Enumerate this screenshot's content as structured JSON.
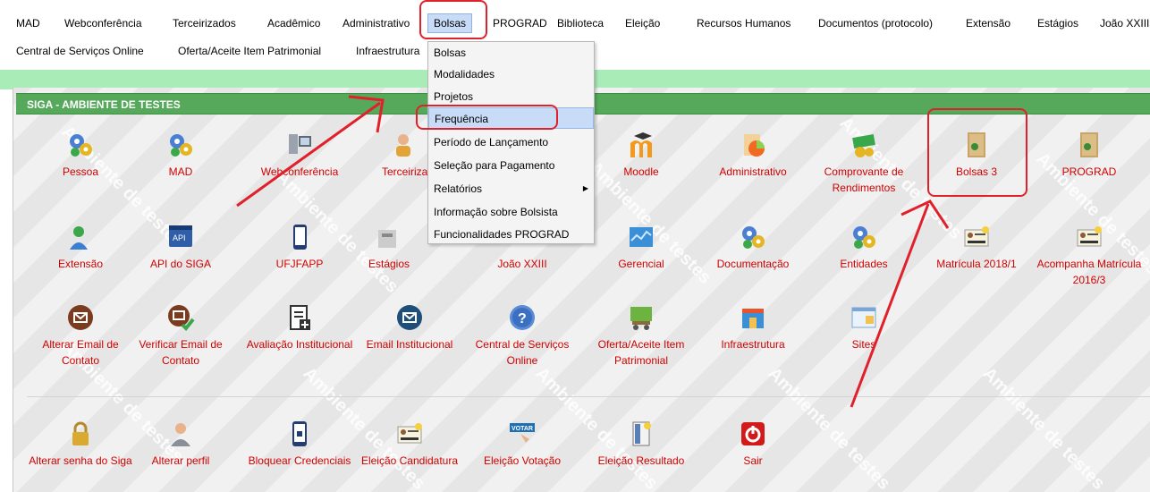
{
  "menubar": {
    "row1": [
      "MAD",
      "Webconferência",
      "Terceirizados",
      "Acadêmico",
      "Administrativo",
      "Bolsas",
      "PROGRAD",
      "Biblioteca",
      "Eleição",
      "Recursos Humanos",
      "Documentos (protocolo)",
      "Extensão",
      "Estágios",
      "João XXIII"
    ],
    "row2": [
      "Central de Serviços Online",
      "Oferta/Aceite Item Patrimonial",
      "Infraestrutura"
    ]
  },
  "panel": {
    "title": "SIGA - AMBIENTE DE TESTES"
  },
  "watermark": "Ambiente de testes",
  "dropdown": {
    "items": [
      "Bolsas",
      "Modalidades",
      "Projetos",
      "Frequência",
      "Período de Lançamento",
      "Seleção para Pagamento",
      "Relatórios",
      "Informação sobre Bolsista",
      "Funcionalidades PROGRAD"
    ],
    "submenu_arrow": "▶"
  },
  "apps": {
    "row1": [
      "Pessoa",
      "MAD",
      "Webconferência",
      "Terceirizados",
      "",
      "Moodle",
      "Administrativo",
      "Comprovante de Rendimentos",
      "Bolsas 3",
      "PROGRAD"
    ],
    "row2": [
      "Extensão",
      "API do SIGA",
      "UFJFAPP",
      "Estágios",
      "João XXIII",
      "Gerencial",
      "Documentação",
      "Entidades",
      "Matrícula 2018/1",
      "Acompanha Matrícula 2016/3"
    ],
    "row3": [
      "Alterar Email de Contato",
      "Verificar Email de Contato",
      "Avaliação Institucional",
      "Email Institucional",
      "Central de Serviços Online",
      "Oferta/Aceite Item Patrimonial",
      "Infraestrutura",
      "Sites"
    ],
    "row4": [
      "Alterar senha do Siga",
      "Alterar perfil",
      "Bloquear Credenciais",
      "Eleição Candidatura",
      "Eleição Votação",
      "Eleição Resultado",
      "Sair"
    ]
  },
  "icons": {
    "gears": "gears-icon",
    "folder": "folder-icon",
    "person": "person-icon",
    "mail": "mail-icon",
    "help": "help-icon",
    "power": "power-icon",
    "lock": "lock-icon",
    "phone": "phone-icon",
    "card": "id-card-icon",
    "vote": "vote-icon"
  },
  "icon_text": {
    "api": "API",
    "vote": "VOTAR",
    "help": "?"
  },
  "colors": {
    "label_red": "#d10000",
    "header_green": "#56a95a",
    "annotation_red": "#e0202a",
    "menu_highlight": "#c9dcf7"
  }
}
